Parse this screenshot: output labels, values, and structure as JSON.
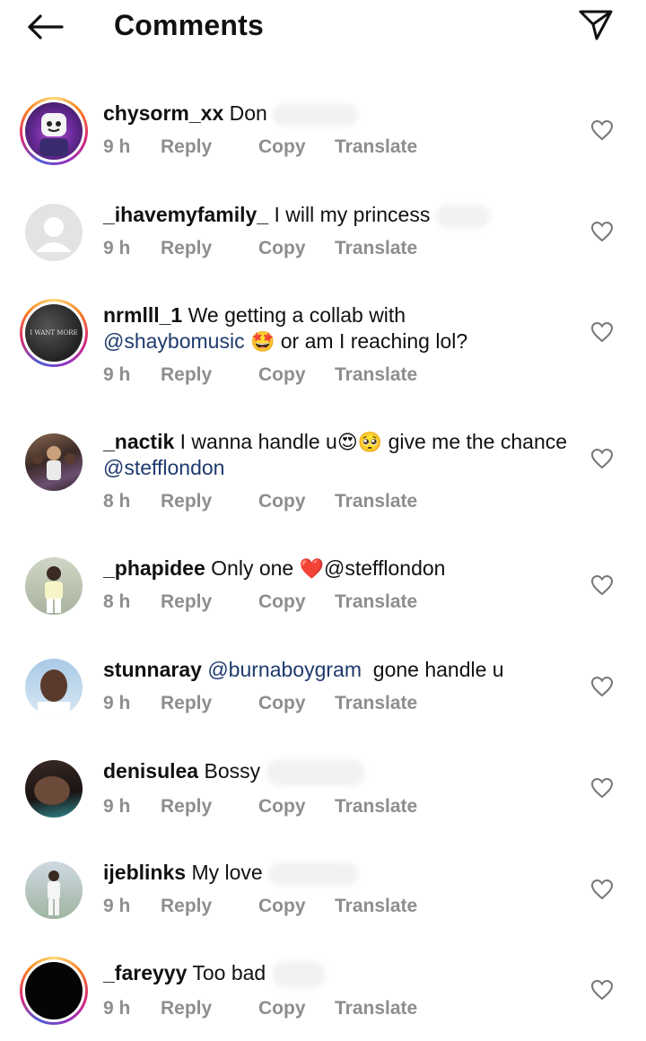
{
  "header": {
    "title": "Comments",
    "back_icon": "arrow-left-icon",
    "send_icon": "paper-plane-icon"
  },
  "actions": {
    "reply": "Reply",
    "copy": "Copy",
    "translate": "Translate"
  },
  "comments": [
    {
      "username": "chysorm_xx",
      "text": "Don",
      "time": "9 h"
    },
    {
      "username": "_ihavemyfamily_",
      "text": "I will my princess",
      "time": "9 h"
    },
    {
      "username": "nrmlll_1",
      "text": "We getting a collab with",
      "mention": "@shaybomusic",
      "text_after": "or am I reaching lol?",
      "time": "9 h",
      "avatar_text": "I WANT MORE"
    },
    {
      "username": "_nactik",
      "text": "I wanna handle u",
      "text_after": "give me the chance",
      "mention": "@stefflondon",
      "time": "8 h"
    },
    {
      "username": "_phapidee",
      "text": "Only one",
      "mention": "@stefflondon",
      "time": "8 h"
    },
    {
      "username": "stunnaray",
      "mention": "@burnaboygram",
      "text_after": "gone handle u",
      "time": "9 h"
    },
    {
      "username": "denisulea",
      "text": "Bossy",
      "time": "9 h"
    },
    {
      "username": "ijeblinks",
      "text": "My love",
      "time": "9 h"
    },
    {
      "username": "_fareyyy",
      "text": "Too bad",
      "time": "9 h"
    }
  ]
}
